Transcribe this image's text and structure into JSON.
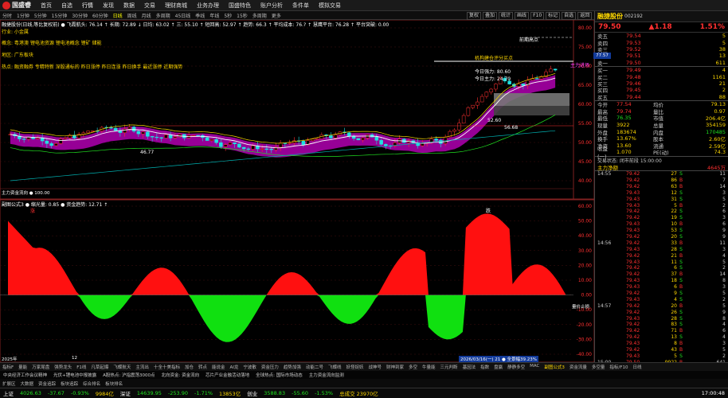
{
  "app": {
    "logo": "国盛睿",
    "menu": [
      "首页",
      "自选",
      "行情",
      "发现",
      "数据",
      "交易",
      "理财商城",
      "业务办理",
      "国盛特色",
      "账户分析",
      "条件单",
      "模拟交易"
    ]
  },
  "toolbar": {
    "items": [
      "分时",
      "1分钟",
      "5分钟",
      "15分钟",
      "30分钟",
      "60分钟",
      "日线",
      "周线",
      "月线",
      "多周期",
      "45日线",
      "季线",
      "年线",
      "5秒",
      "15秒",
      "多周期",
      "更多"
    ],
    "active_index": 6,
    "right_buttons": [
      "复权",
      "叠加",
      "统计",
      "画线",
      "F10",
      "标记",
      "自选",
      "返回"
    ]
  },
  "main_chart": {
    "header": "融捷股份(日线,等比复权前) ● 飞霞航头: 76.14 ↑ 长期: 72.89 ↓ 日均: 63.02 ↑ 三: 55.10 ↑ 短回高: 52.97 ↑ 趋势: 66.3 ↑ 平均成本: 76.? ↑ 慧鹰平台: 76.28 ↑ 平台突破: 0.00",
    "info_lines": [
      {
        "text": "行业: 小金属",
        "color": "#ffd800"
      },
      {
        "text": "概念: 粤港澳 锂电池资源 锂电池概念 锂矿 储能",
        "color": "#ffd800"
      },
      {
        "text": "地区: 广东板块",
        "color": "#ffd800"
      },
      {
        "text": "热点: 融资融券 专精特新 深股通标的 昨日涨停 昨日连涨 昨日换手 最近涨停 近期强势",
        "color": "#ffd800"
      }
    ],
    "label_top": "前期高点",
    "annotations": [
      {
        "text": "机构建仓评分买点",
        "color": "#ffd800"
      },
      {
        "text": "今日强力: 80.60",
        "color": "#ffffff"
      },
      {
        "text": "今日主力: 24.70",
        "color": "#ffffff"
      },
      {
        "text": "主力进场",
        "color": "#ff40ff"
      },
      {
        "text": "52.60",
        "color": "#ffffff"
      },
      {
        "text": "56.68",
        "color": "#ffffff"
      },
      {
        "text": "46.77",
        "color": "#ffffff"
      }
    ],
    "price_axis": [
      "80.00",
      "75.00",
      "70.00",
      "65.00",
      "60.00",
      "55.00",
      "50.00",
      "45.00",
      "40.00"
    ],
    "current_price_tag": "77.57",
    "volume_label": "主力资金流向 ● 100.00"
  },
  "sub_chart": {
    "header": "副图公式3 ● 缩光量: 0.85 ● 资金趋势: 12.71 ↑",
    "label_top": "涨",
    "label_bottom": "跌",
    "label_right": "量价止损",
    "axis": [
      "60.00",
      "50.00",
      "40.00",
      "30.00",
      "20.00",
      "10.00",
      "0.00",
      "-10.00",
      "-20.00",
      "-30.00",
      "-40.00"
    ],
    "date_left": "2025年",
    "date_mid": "12",
    "date_right": "2026/03/16(一)  21 ● 全景幅39.23%"
  },
  "right_panel": {
    "name": "融捷股份",
    "code": "002192",
    "price": "79.50",
    "change": "▲1.18",
    "pct": "1.51%",
    "asks": [
      {
        "label": "卖五",
        "price": "79.54",
        "vol": "5"
      },
      {
        "label": "卖四",
        "price": "79.53",
        "vol": "5"
      },
      {
        "label": "卖三",
        "price": "79.52",
        "vol": "38"
      },
      {
        "label": "卖二",
        "price": "79.51",
        "vol": "13"
      },
      {
        "label": "卖一",
        "price": "79.50",
        "vol": "611"
      }
    ],
    "bids": [
      {
        "label": "买一",
        "price": "79.49",
        "vol": "4"
      },
      {
        "label": "买二",
        "price": "79.48",
        "vol": "1161"
      },
      {
        "label": "买三",
        "price": "79.46",
        "vol": "21"
      },
      {
        "label": "买四",
        "price": "79.45",
        "vol": "2"
      },
      {
        "label": "买五",
        "price": "79.44",
        "vol": "88"
      }
    ],
    "stats": [
      {
        "k": "今开",
        "v": "77.54",
        "k2": "均价",
        "v2": "79.13"
      },
      {
        "k": "最高",
        "v": "79.74",
        "k2": "量比",
        "v2": "0.97"
      },
      {
        "k": "最低",
        "v": "76.35",
        "k2": "市值",
        "v2": "206.4亿"
      },
      {
        "k": "现量",
        "v": "3922",
        "k2": "总量",
        "v2": "354159"
      },
      {
        "k": "外盘",
        "v": "183674",
        "k2": "内盘",
        "v2": "170485"
      },
      {
        "k": "换手",
        "v": "13.67%",
        "k2": "股本",
        "v2": "2.60亿"
      },
      {
        "k": "净资",
        "v": "13.60",
        "k2": "流通",
        "v2": "2.59亿"
      },
      {
        "k": "收益(一)",
        "v": "1.070",
        "k2": "PE(动)",
        "v2": "74.3"
      }
    ],
    "trade_status": "交易状态: 闭市前段 15:00:00",
    "main_net": "主力净额",
    "main_net_val": "4645万",
    "ticks": [
      {
        "t": "14:55",
        "p": "79.42",
        "v": "27",
        "bs": "S",
        "n": "11"
      },
      {
        "t": "",
        "p": "79.42",
        "v": "86",
        "bs": "B",
        "n": "7"
      },
      {
        "t": "",
        "p": "79.42",
        "v": "63",
        "bs": "B",
        "n": "14"
      },
      {
        "t": "",
        "p": "79.43",
        "v": "12",
        "bs": "S",
        "n": "3"
      },
      {
        "t": "",
        "p": "79.43",
        "v": "31",
        "bs": "S",
        "n": "5"
      },
      {
        "t": "",
        "p": "79.43",
        "v": "5",
        "bs": "B",
        "n": "2"
      },
      {
        "t": "",
        "p": "79.42",
        "v": "22",
        "bs": "S",
        "n": "6"
      },
      {
        "t": "",
        "p": "79.42",
        "v": "19",
        "bs": "S",
        "n": "3"
      },
      {
        "t": "",
        "p": "79.43",
        "v": "10",
        "bs": "B",
        "n": "6"
      },
      {
        "t": "",
        "p": "79.43",
        "v": "53",
        "bs": "S",
        "n": "9"
      },
      {
        "t": "",
        "p": "79.42",
        "v": "20",
        "bs": "S",
        "n": "9"
      },
      {
        "t": "14:56",
        "p": "79.42",
        "v": "33",
        "bs": "B",
        "n": "11"
      },
      {
        "t": "",
        "p": "79.43",
        "v": "28",
        "bs": "S",
        "n": "3"
      },
      {
        "t": "",
        "p": "79.42",
        "v": "21",
        "bs": "B",
        "n": "4"
      },
      {
        "t": "",
        "p": "79.43",
        "v": "11",
        "bs": "S",
        "n": "5"
      },
      {
        "t": "",
        "p": "79.42",
        "v": "6",
        "bs": "S",
        "n": "2"
      },
      {
        "t": "",
        "p": "79.42",
        "v": "37",
        "bs": "B",
        "n": "14"
      },
      {
        "t": "",
        "p": "79.43",
        "v": "18",
        "bs": "S",
        "n": "8"
      },
      {
        "t": "",
        "p": "79.43",
        "v": "6",
        "bs": "B",
        "n": "3"
      },
      {
        "t": "",
        "p": "79.42",
        "v": "9",
        "bs": "S",
        "n": "5"
      },
      {
        "t": "",
        "p": "79.43",
        "v": "4",
        "bs": "S",
        "n": "2"
      },
      {
        "t": "14:57",
        "p": "79.42",
        "v": "20",
        "bs": "B",
        "n": "5"
      },
      {
        "t": "",
        "p": "79.42",
        "v": "26",
        "bs": "S",
        "n": "9"
      },
      {
        "t": "",
        "p": "79.43",
        "v": "28",
        "bs": "S",
        "n": "8"
      },
      {
        "t": "",
        "p": "79.42",
        "v": "83",
        "bs": "S",
        "n": "4"
      },
      {
        "t": "",
        "p": "79.42",
        "v": "71",
        "bs": "B",
        "n": "6"
      },
      {
        "t": "",
        "p": "79.42",
        "v": "13",
        "bs": "S",
        "n": "4"
      },
      {
        "t": "",
        "p": "79.43",
        "v": "8",
        "bs": "B",
        "n": "3"
      },
      {
        "t": "",
        "p": "79.42",
        "v": "43",
        "bs": "B",
        "n": "5"
      },
      {
        "t": "",
        "p": "79.43",
        "v": "5",
        "bs": "S",
        "n": "2"
      },
      {
        "t": "15:00",
        "p": "79.50",
        "v": "9922",
        "bs": "B",
        "n": "641"
      }
    ]
  },
  "bottom_tabs": {
    "items": [
      "指标F",
      "量能",
      "万家尾盘",
      "强势龙头",
      "F1线",
      "凡草起爆",
      "飞蝶航天",
      "主流出",
      "十全十美指标",
      "加仓",
      "转点",
      "能说金",
      "AI龙",
      "宁波散",
      "资金压力",
      "趋势加强",
      "动能二号",
      "飞蝶线",
      "妖怪捉妖",
      "战神号",
      "财神到家",
      "多空",
      "牛量能",
      "三元判断",
      "基因法",
      "指数",
      "盘赢",
      "静静多空",
      "MAC",
      "副图公式3",
      "资金流量",
      "多空量"
    ],
    "active_index": 29,
    "right": [
      "指标/F10",
      "日线"
    ]
  },
  "news_bar": [
    "中央经济工作会议精神",
    "光伏+锂电池中报披露",
    "A股热点: 沪指震荡3000点",
    "北向资金: 资金流向",
    "芯片产业金融活动落地",
    "全球热点: 国际市场动态",
    "主力资金流向监测"
  ],
  "tabs_bar2": [
    "扩展区",
    "大数据",
    "资金追踪",
    "板块追踪",
    "综合排名",
    "板块排名"
  ],
  "status_bar": {
    "sh_label": "上证",
    "sh_val": "4026.63",
    "sh_chg": "-37.67",
    "sh_pct": "-0.93%",
    "sh_amt": "9984亿",
    "sz_label": "深证",
    "sz_val": "14639.95",
    "sz_chg": "-253.90",
    "sz_pct": "-1.71%",
    "sz_amt": "13853亿",
    "cy_label": "创业",
    "cy_val": "3588.83",
    "cy_chg": "-55.60",
    "cy_pct": "-1.53%",
    "cy_amt": "总成交 23970亿",
    "time": "17:00:48"
  }
}
